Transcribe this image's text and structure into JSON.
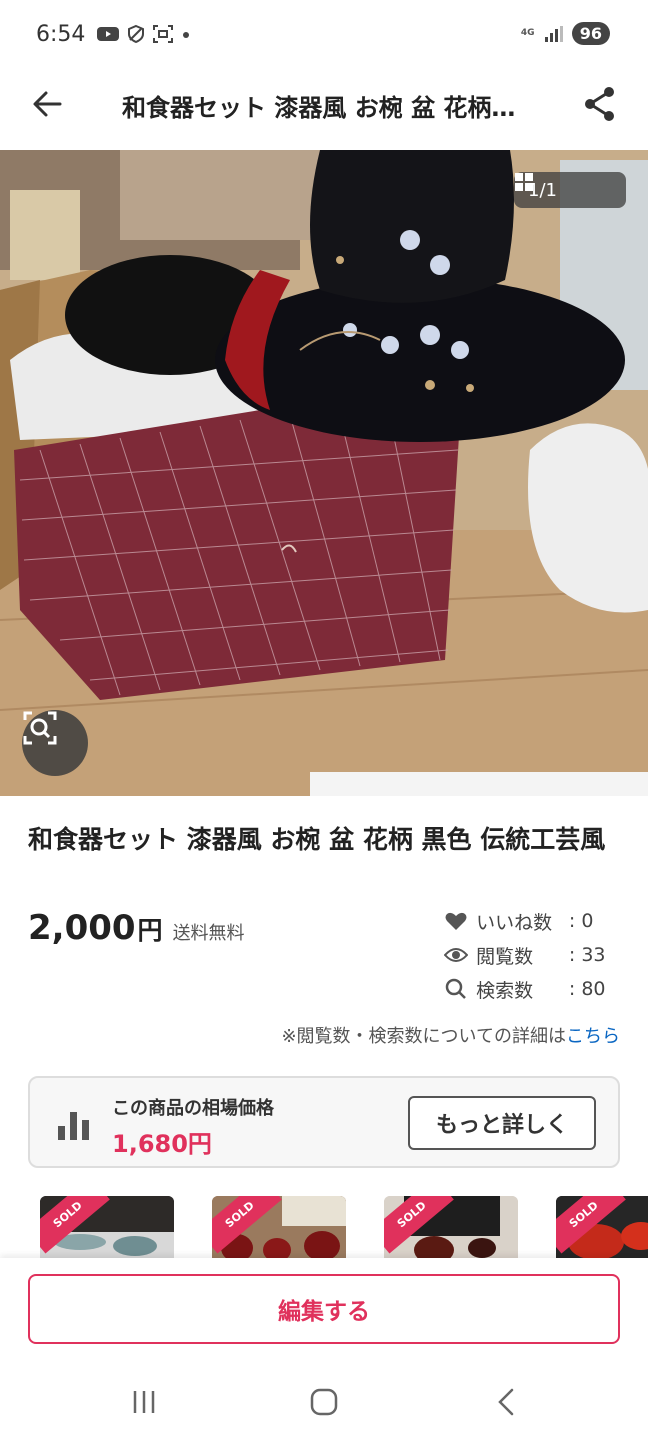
{
  "status_bar": {
    "time": "6:54",
    "network": "4G",
    "battery": "96"
  },
  "header": {
    "title": "和食器セット 漆器風 お椀 盆 花柄…",
    "icons": [
      "back-arrow-icon",
      "share-icon"
    ]
  },
  "photo": {
    "counter": "1/1",
    "icons": [
      "grid-icon",
      "image-search-icon"
    ]
  },
  "product": {
    "title": "和食器セット 漆器風 お椀 盆 花柄 黒色 伝統工芸風",
    "price": "2,000",
    "currency": "円",
    "shipping": "送料無料"
  },
  "stats": [
    {
      "icon": "heart-icon",
      "label": "いいね数",
      "sep": ":",
      "value": "0"
    },
    {
      "icon": "eye-icon",
      "label": "閲覧数",
      "sep": ":",
      "value": "33"
    },
    {
      "icon": "search-icon",
      "label": "検索数",
      "sep": ":",
      "value": "80"
    }
  ],
  "note": {
    "text": "※閲覧数・検索数についての詳細は",
    "link": "こちら"
  },
  "market": {
    "label": "この商品の相場価格",
    "price": "1,680円",
    "button": "もっと詳しく"
  },
  "sold_thumbnails": [
    {
      "badge": "SOLD"
    },
    {
      "badge": "SOLD"
    },
    {
      "badge": "SOLD"
    },
    {
      "badge": "SOLD"
    }
  ],
  "actions": {
    "edit_button": "編集する"
  },
  "colors": {
    "accent": "#e0315c",
    "link": "#0a66c2"
  }
}
